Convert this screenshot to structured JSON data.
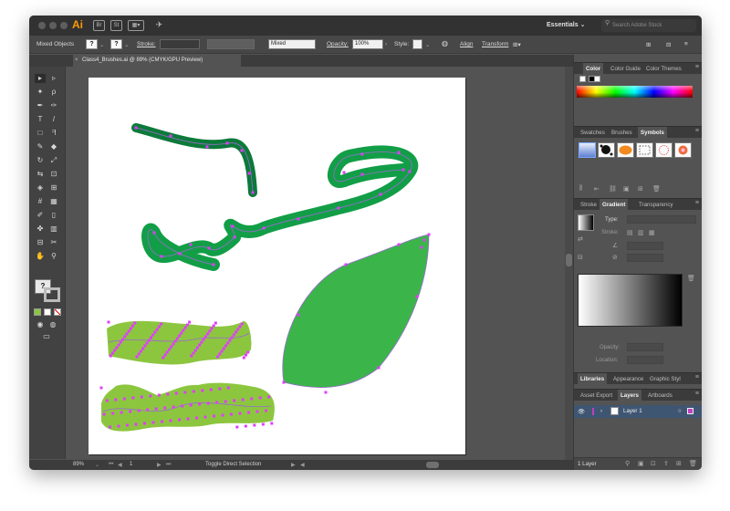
{
  "app": {
    "logo": "Ai",
    "bridge": "Br",
    "stock": "St",
    "workspace": "Essentials",
    "search_placeholder": "Search Adobe Stock"
  },
  "document": {
    "tab_title": "Class4_Brushes.ai @ 89% (CMYK/GPU Preview)",
    "close_glyph": "×"
  },
  "control_bar": {
    "selection": "Mixed Objects",
    "fill": "?",
    "stroke_label": "Stroke:",
    "stroke_weight": "",
    "brush": "Mixed",
    "opacity_label": "Opacity:",
    "opacity": "100%",
    "style_label": "Style:",
    "align": "Align",
    "transform": "Transform"
  },
  "tools": [
    "selection-tool",
    "direct-selection-tool",
    "magic-wand-tool",
    "lasso-tool",
    "pen-tool",
    "curvature-tool",
    "type-tool",
    "line-tool",
    "rectangle-tool",
    "paintbrush-tool",
    "shaper-tool",
    "eraser-tool",
    "rotate-tool",
    "scale-tool",
    "width-tool",
    "free-transform-tool",
    "shape-builder-tool",
    "perspective-grid-tool",
    "mesh-tool",
    "gradient-tool",
    "eyedropper-tool",
    "blend-tool",
    "symbol-sprayer-tool",
    "column-graph-tool",
    "artboard-tool",
    "slice-tool",
    "hand-tool",
    "zoom-tool"
  ],
  "tool_glyphs": [
    "▸",
    "▹",
    "✦",
    "ρ",
    "✒",
    "✑",
    "T",
    "/",
    "□",
    "ᖷ",
    "✎",
    "◆",
    "↻",
    "⤢",
    "⇆",
    "⊡",
    "◈",
    "⊞",
    "#",
    "▦",
    "✐",
    "▯",
    "✤",
    "▥",
    "⊟",
    "✂",
    "✋",
    "⚲"
  ],
  "fill_stroke": {
    "fill": "?",
    "default_colors": "",
    "swap": ""
  },
  "status": {
    "zoom": "89%",
    "page": "1",
    "tool_hint": "Toggle Direct Selection"
  },
  "panels": {
    "color_tabs": [
      "Color",
      "Color Guide",
      "Color Themes"
    ],
    "swatch_tabs": [
      "Swatches",
      "Brushes",
      "Symbols"
    ],
    "gradient_tabs": [
      "Stroke",
      "Gradient",
      "Transparency"
    ],
    "gradient": {
      "type_label": "Type:",
      "stroke_label": "Stroke:",
      "opacity_label": "Opacity:",
      "location_label": "Location:"
    },
    "libraries_tabs": [
      "Libraries",
      "Appearance",
      "Graphic Styl"
    ],
    "layers_tabs": [
      "Asset Export",
      "Layers",
      "Artboards"
    ],
    "layers": [
      {
        "name": "Layer 1"
      }
    ],
    "layers_count": "1 Layer"
  },
  "colors": {
    "accent": "#ff9a00",
    "dark_green": "#0c7a3a",
    "mid_green": "#129e47",
    "leaf_green": "#3bb54a",
    "lime_green": "#8cc63f",
    "anchor": "#e23cff"
  }
}
